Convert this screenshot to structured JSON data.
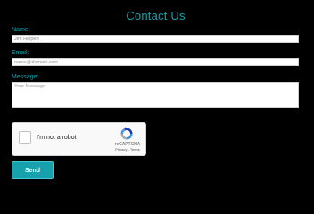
{
  "form": {
    "title": "Contact Us",
    "name_label": "Name:",
    "name_value": "Jim Halpert",
    "email_label": "Email:",
    "email_placeholder": "name@domain.com",
    "message_label": "Message:",
    "message_placeholder": "Your Message",
    "send_label": "Send"
  },
  "captcha": {
    "label": "I'm not a robot",
    "brand": "reCAPTCHA",
    "links": "Privacy - Terms"
  },
  "colors": {
    "accent": "#17a2ad",
    "background": "#000000",
    "button": "#16a1ac"
  }
}
